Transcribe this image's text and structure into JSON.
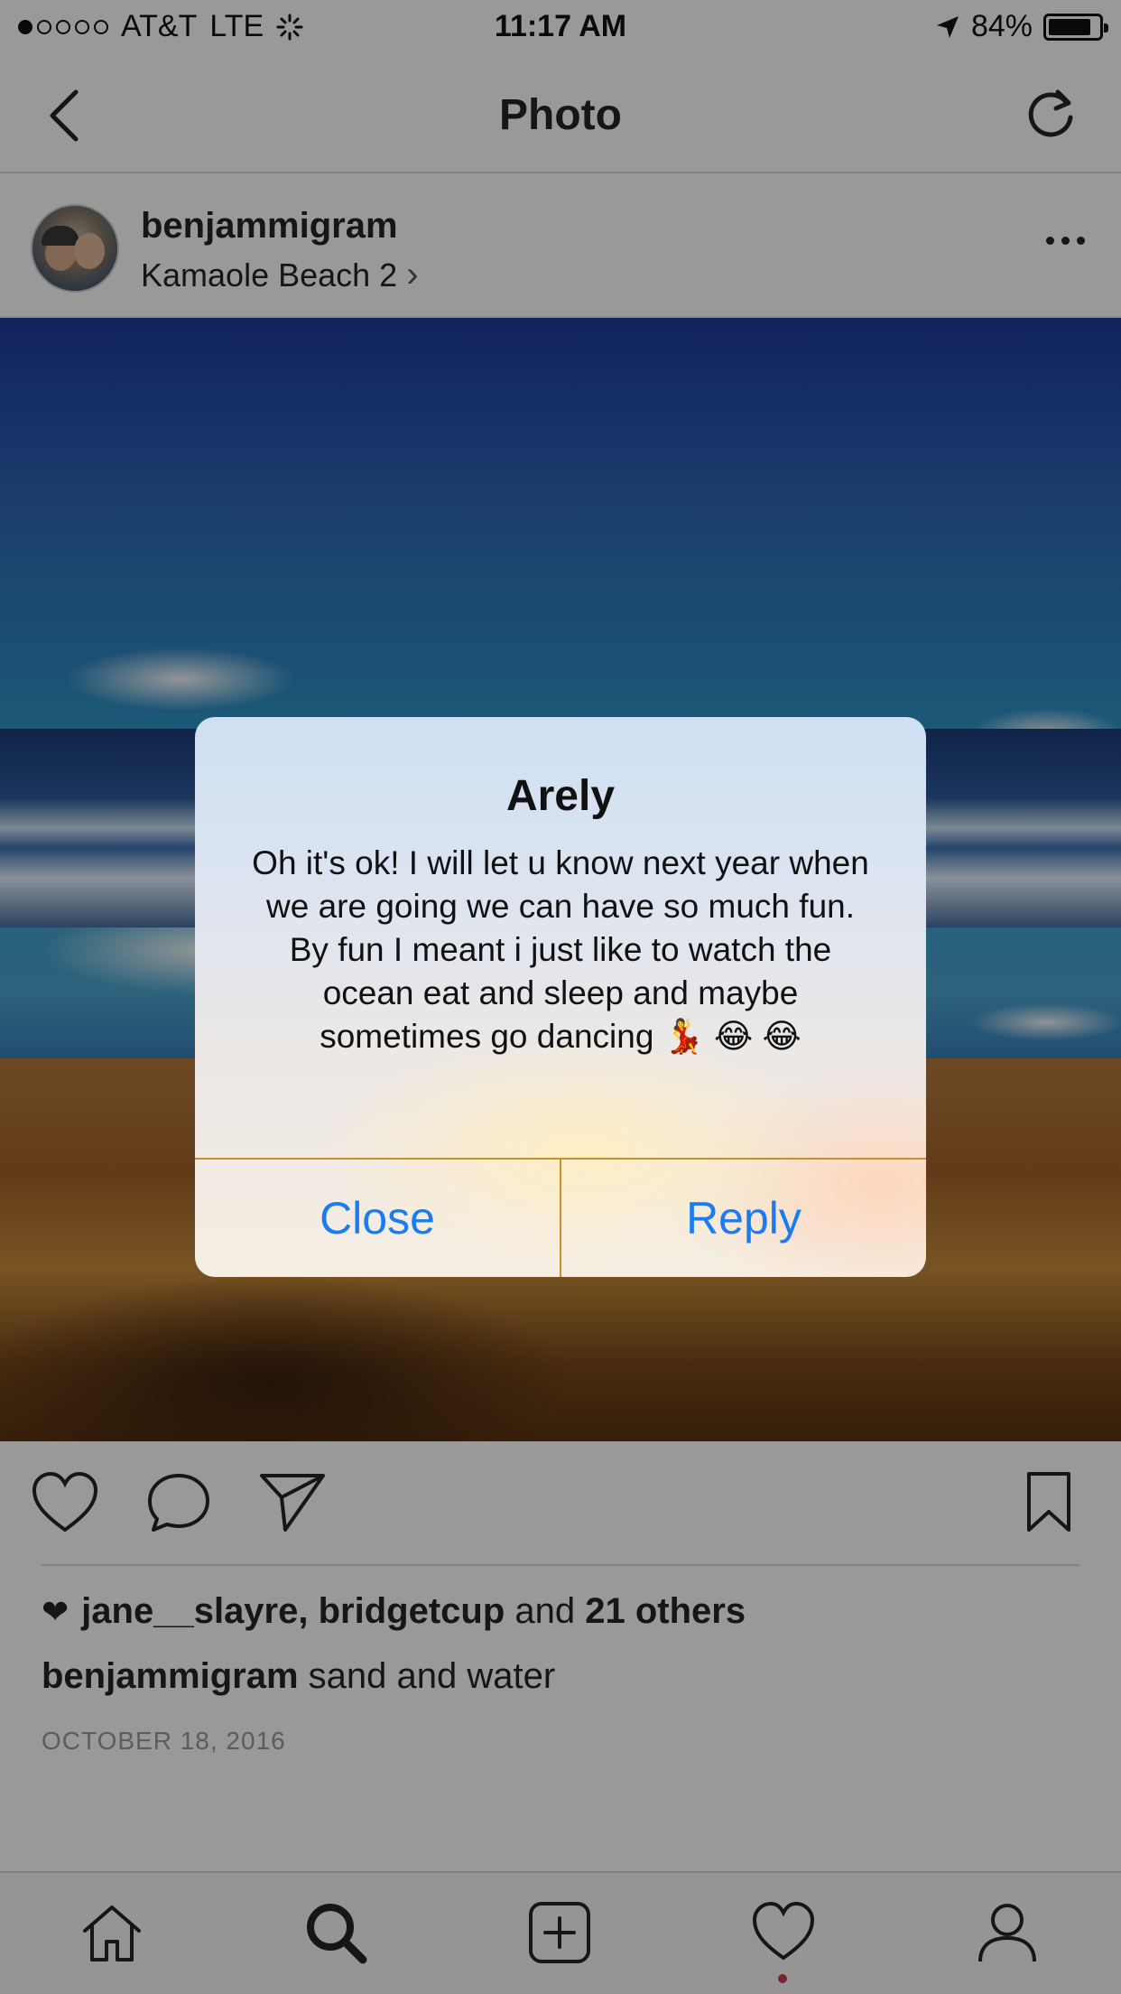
{
  "status_bar": {
    "carrier": "AT&T",
    "network": "LTE",
    "time": "11:17 AM",
    "battery": "84%",
    "signal_bars": 1,
    "signal_total": 5
  },
  "nav": {
    "title": "Photo"
  },
  "post": {
    "username": "benjammigram",
    "location": "Kamaole Beach 2",
    "location_chevron": "›"
  },
  "likes": {
    "heart": "❤",
    "names": "jane__slayre, bridgetcup",
    "and": "and",
    "others": "21 others"
  },
  "caption": {
    "username": "benjammigram",
    "text": "sand and water"
  },
  "date": "OCTOBER 18, 2016",
  "alert": {
    "title": "Arely",
    "message": "Oh it's ok! I will let u know next year when we are going we can have so much fun. By fun I meant i just like to watch the ocean eat and sleep and maybe sometimes go dancing 💃 😂 😂",
    "close_label": "Close",
    "reply_label": "Reply",
    "button_color": "#1a7cf0"
  },
  "tabs": [
    "home-icon",
    "search-icon",
    "add-icon",
    "activity-icon",
    "profile-icon"
  ]
}
